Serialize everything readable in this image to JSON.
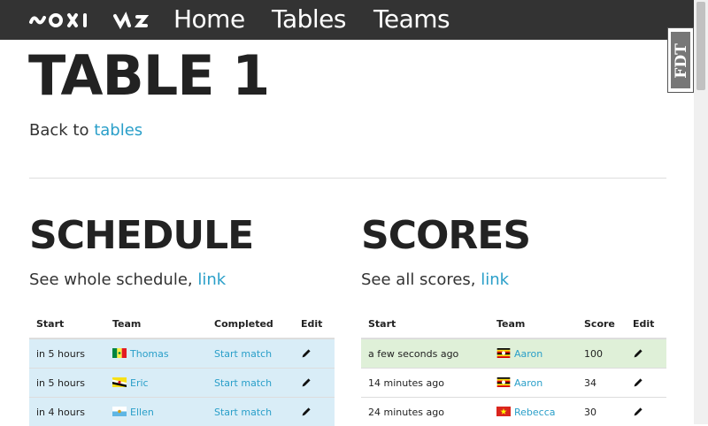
{
  "nav": {
    "items": [
      "Home",
      "Tables",
      "Teams"
    ]
  },
  "badge": {
    "text": "FDT"
  },
  "page": {
    "title": "TABLE 1",
    "back_prefix": "Back to ",
    "back_link": "tables"
  },
  "schedule": {
    "title": "SCHEDULE",
    "subtitle_prefix": "See whole schedule, ",
    "subtitle_link": "link",
    "columns": [
      "Start",
      "Team",
      "Completed",
      "Edit"
    ],
    "rows": [
      {
        "start": "in 5 hours",
        "team": "Thomas",
        "flag": "senegal-flag",
        "completed": "Start match"
      },
      {
        "start": "in 5 hours",
        "team": "Eric",
        "flag": "brunei-flag",
        "completed": "Start match"
      },
      {
        "start": "in 4 hours",
        "team": "Ellen",
        "flag": "san-marino-flag",
        "completed": "Start match"
      }
    ]
  },
  "scores": {
    "title": "SCORES",
    "subtitle_prefix": "See all scores, ",
    "subtitle_link": "link",
    "columns": [
      "Start",
      "Team",
      "Score",
      "Edit"
    ],
    "rows": [
      {
        "start": "a few seconds ago",
        "team": "Aaron",
        "flag": "uganda-flag",
        "score": "100"
      },
      {
        "start": "14 minutes ago",
        "team": "Aaron",
        "flag": "uganda-flag",
        "score": "34"
      },
      {
        "start": "24 minutes ago",
        "team": "Rebecca",
        "flag": "vietnam-flag",
        "score": "30"
      }
    ]
  },
  "colors": {
    "navbar": "#333333",
    "link": "#2a9fc9",
    "info_row": "#d9edf7",
    "success_row": "#dff0d8"
  }
}
